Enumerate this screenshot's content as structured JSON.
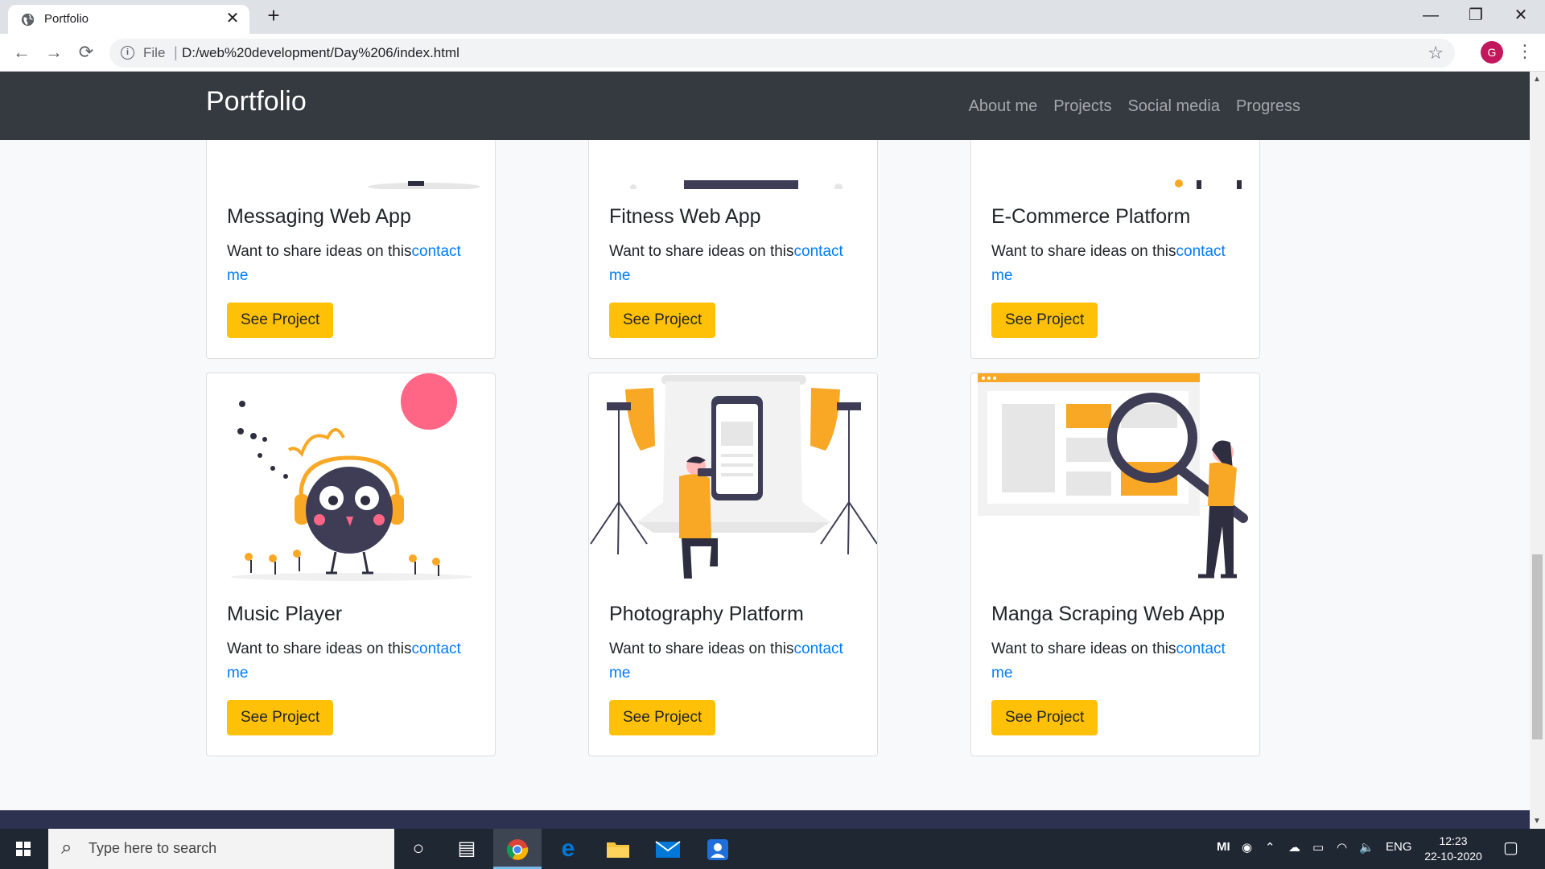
{
  "browser": {
    "tab_title": "Portfolio",
    "tab_close": "✕",
    "new_tab": "+",
    "url_scheme": "File",
    "url": "D:/web%20development/Day%206/index.html",
    "profile_initial": "G",
    "window_controls": [
      "—",
      "❐",
      "✕"
    ]
  },
  "site": {
    "brand": "Portfolio",
    "nav": [
      "About me",
      "Projects",
      "Social media",
      "Progress"
    ]
  },
  "cards": [
    {
      "title": "Messaging Web App",
      "text": "Want to share ideas on this",
      "link": "contact me",
      "button": "See Project"
    },
    {
      "title": "Fitness Web App",
      "text": "Want to share ideas on this",
      "link": "contact me",
      "button": "See Project"
    },
    {
      "title": "E-Commerce Platform",
      "text": "Want to share ideas on this",
      "link": "contact me",
      "button": "See Project"
    },
    {
      "title": "Music Player",
      "text": "Want to share ideas on this",
      "link": "contact me",
      "button": "See Project"
    },
    {
      "title": "Photography Platform",
      "text": "Want to share ideas on this",
      "link": "contact me",
      "button": "See Project"
    },
    {
      "title": "Manga Scraping Web App",
      "text": "Want to share ideas on this",
      "link": "contact me",
      "button": "See Project"
    }
  ],
  "taskbar": {
    "search_placeholder": "Type here to search",
    "language": "ENG",
    "time": "12:23",
    "date": "22-10-2020",
    "tray_mi": "MI"
  },
  "colors": {
    "navbar": "#343a40",
    "accent_button": "#ffc107",
    "link": "#007bff",
    "illustration_accent": "#f9a826",
    "taskbar": "#1f2733"
  }
}
